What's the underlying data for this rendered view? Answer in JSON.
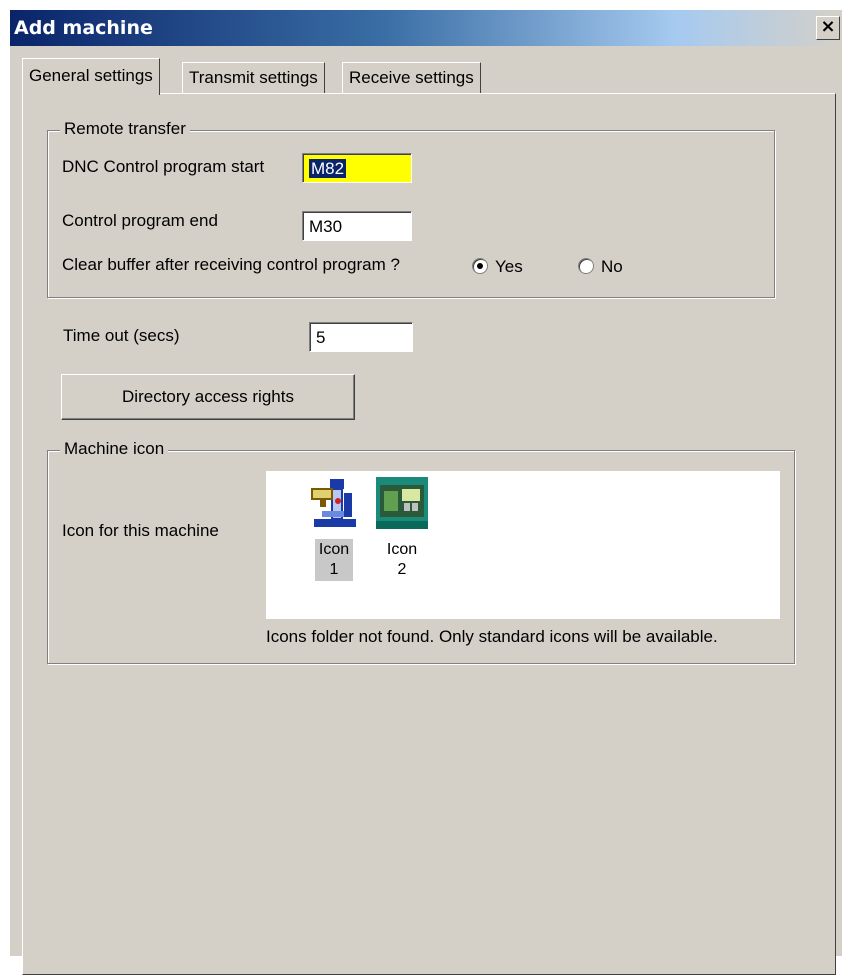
{
  "window": {
    "title": "Add machine",
    "close_glyph": "×"
  },
  "tabs": [
    {
      "label": "General settings",
      "active": true
    },
    {
      "label": "Transmit settings",
      "active": false
    },
    {
      "label": "Receive settings",
      "active": false
    }
  ],
  "remote_transfer": {
    "legend": "Remote transfer",
    "dnc_start_label": "DNC Control program start",
    "dnc_start_value": "M82",
    "program_end_label": "Control program end",
    "program_end_value": "M30",
    "clear_buffer_label": "Clear buffer after receiving control program ?",
    "yes_label": "Yes",
    "no_label": "No",
    "clear_buffer_selected": "Yes"
  },
  "timeout": {
    "label": "Time out (secs)",
    "value": "5"
  },
  "directory_button": "Directory access rights",
  "machine_icon": {
    "legend": "Machine icon",
    "label": "Icon for this machine",
    "icons": [
      {
        "line1": "Icon",
        "line2": "1",
        "icon": "milling-machine-icon",
        "selected": true
      },
      {
        "line1": "Icon",
        "line2": "2",
        "icon": "cnc-lathe-icon",
        "selected": false
      }
    ],
    "note": "Icons folder not found. Only standard icons will be available."
  },
  "colors": {
    "title_start": "#0a246a",
    "title_end": "#a6caf0",
    "face": "#d4d0c8",
    "highlight_field": "#ffff00"
  }
}
